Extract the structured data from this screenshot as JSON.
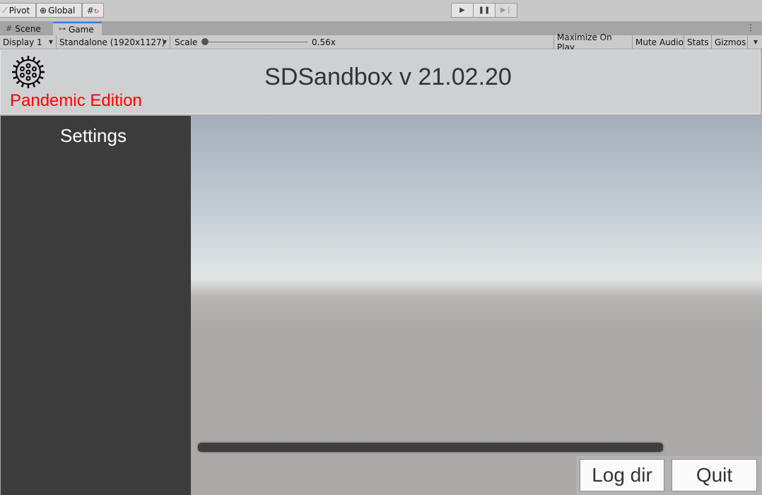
{
  "toolbar": {
    "pivot_label": "Pivot",
    "global_label": "Global",
    "play_icon": "play-icon",
    "pause_icon": "pause-icon",
    "step_icon": "step-icon"
  },
  "tabs": [
    {
      "label": "Scene",
      "icon": "grid-icon",
      "active": false
    },
    {
      "label": "Game",
      "icon": "gamepad-icon",
      "active": true
    }
  ],
  "game_controls": {
    "display": "Display 1",
    "resolution": "Standalone (1920x1127)",
    "scale_label": "Scale",
    "scale_value": "0.56x",
    "maximize_label": "Maximize On Play",
    "mute_label": "Mute Audio",
    "stats_label": "Stats",
    "gizmos_label": "Gizmos"
  },
  "app": {
    "title": "SDSandbox v 21.02.20",
    "edition": "Pandemic Edition",
    "edition_color": "#ff0000",
    "settings_title": "Settings",
    "log_dir_label": "Log dir",
    "quit_label": "Quit"
  },
  "colors": {
    "sidebar": "#3c3c3c",
    "tab_accent": "#3a79d8"
  }
}
